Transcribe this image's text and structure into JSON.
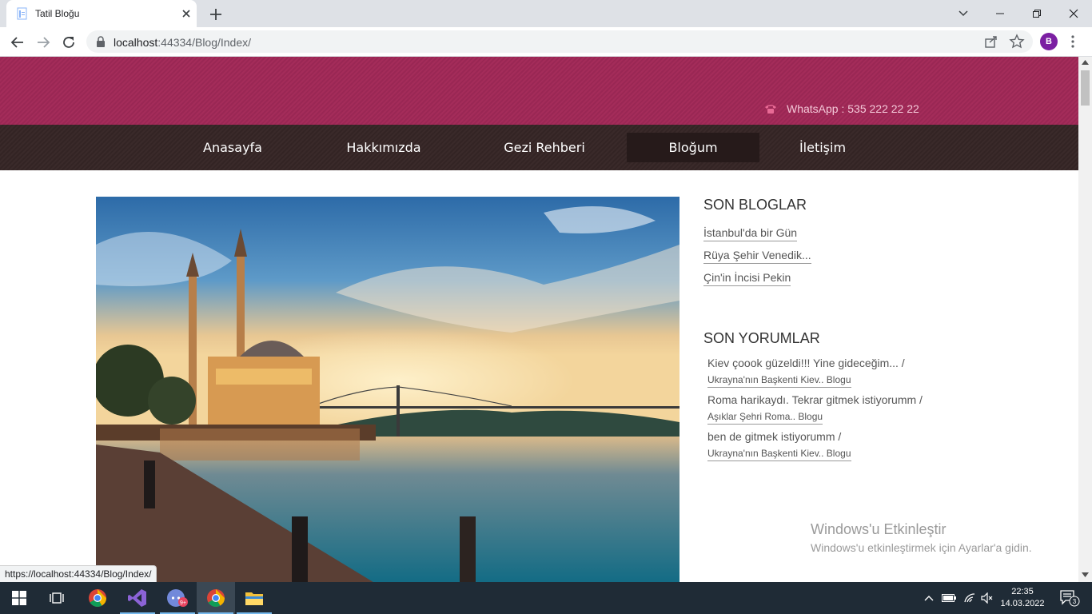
{
  "browser": {
    "tab_title": "Tatil Bloğu",
    "url_host": "localhost",
    "url_rest": ":44334/Blog/Index/",
    "profile_initial": "B",
    "status_url": "https://localhost:44334/Blog/Index/"
  },
  "header": {
    "whatsapp": "WhatsApp : 535 222 22 22"
  },
  "nav": {
    "items": [
      "Anasayfa",
      "Hakkımızda",
      "Gezi Rehberi",
      "Bloğum",
      "İletişim"
    ],
    "active_index": 3
  },
  "sidebar": {
    "recent_blogs_title": "SON BLOGLAR",
    "recent_blogs": [
      "İstanbul'da bir Gün",
      "Rüya Şehir Venedik...",
      "Çin'in İncisi Pekin"
    ],
    "recent_comments_title": "SON YORUMLAR",
    "comments": [
      {
        "text": "Kiev çoook güzeldi!!! Yine gideceğim... /",
        "link": "Ukrayna'nın Başkenti Kiev.. Blogu"
      },
      {
        "text": "Roma harikaydı. Tekrar gitmek istiyorumm /",
        "link": "Aşıklar Şehri Roma.. Blogu"
      },
      {
        "text": "ben de gitmek istiyorumm /",
        "link": "Ukrayna'nın Başkenti Kiev.. Blogu"
      }
    ]
  },
  "watermark": {
    "line1": "Windows'u Etkinleştir",
    "line2": "Windows'u etkinleştirmek için Ayarlar'a gidin."
  },
  "taskbar": {
    "time": "22:35",
    "date": "14.03.2022",
    "notification_count": "3",
    "discord_badge": "9+"
  },
  "colors": {
    "header_bg": "#a42c5a",
    "nav_bg": "#3a2a2a",
    "nav_active_bg": "#261a1a",
    "taskbar_bg": "#1f2b36"
  }
}
